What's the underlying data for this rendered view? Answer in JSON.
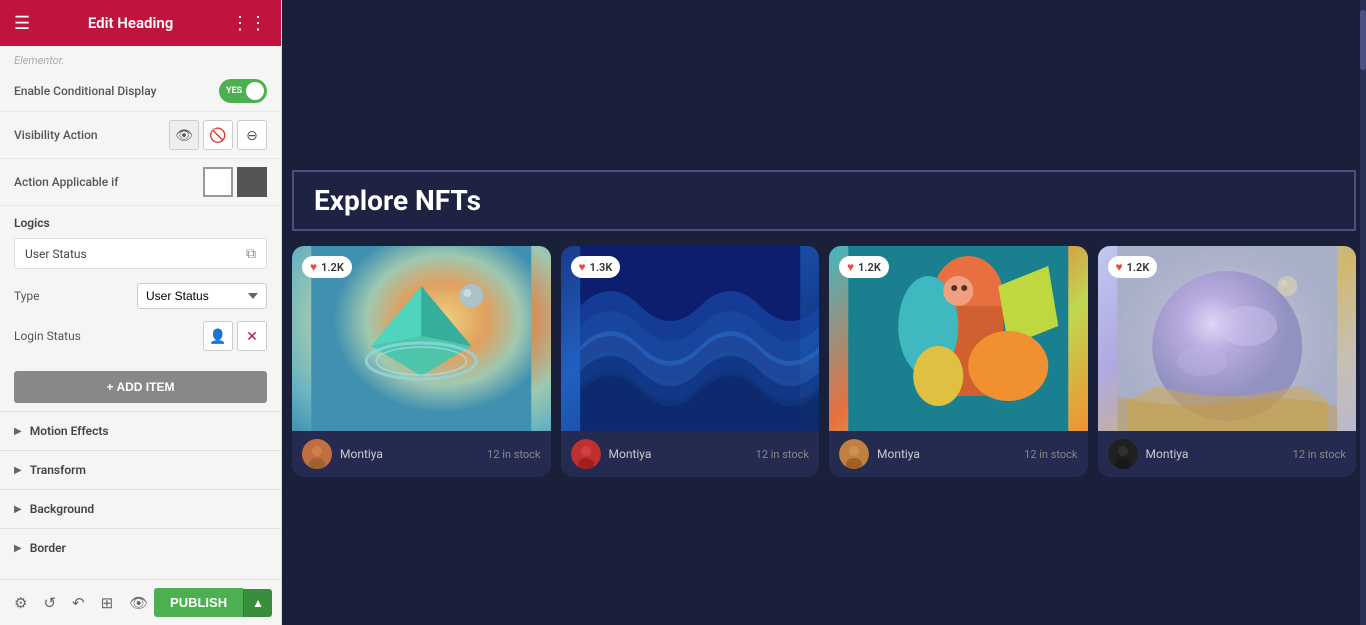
{
  "panel": {
    "title": "Edit Heading",
    "elementor_label": "Elementor.",
    "conditional_display": {
      "label": "Enable Conditional Display",
      "value": "YES",
      "enabled": true
    },
    "visibility_action": {
      "label": "Visibility Action",
      "options": [
        "show",
        "hide",
        "toggle"
      ]
    },
    "action_applicable_if": {
      "label": "Action Applicable if"
    },
    "logics": {
      "title": "Logics",
      "item_label": "User Status",
      "type_label": "Type",
      "type_value": "User Status",
      "login_status_label": "Login Status"
    },
    "add_item_button": "+ ADD ITEM",
    "sections": [
      {
        "title": "Motion Effects"
      },
      {
        "title": "Transform"
      },
      {
        "title": "Background"
      },
      {
        "title": "Border"
      }
    ]
  },
  "toolbar": {
    "publish_label": "PUBLISH",
    "icons": [
      "settings",
      "history",
      "undo",
      "responsive",
      "eye"
    ]
  },
  "content": {
    "explore_title": "Explore NFTs",
    "cards": [
      {
        "likes": "1.2K",
        "artist": "Montiya",
        "stock": "12 in stock",
        "type": "geometric"
      },
      {
        "likes": "1.3K",
        "artist": "Montiya",
        "stock": "12 in stock",
        "type": "waves"
      },
      {
        "likes": "1.2K",
        "artist": "Montiya",
        "stock": "12 in stock",
        "type": "figure"
      },
      {
        "likes": "1.2K",
        "artist": "Montiya",
        "stock": "12 in stock",
        "type": "planet"
      }
    ]
  }
}
